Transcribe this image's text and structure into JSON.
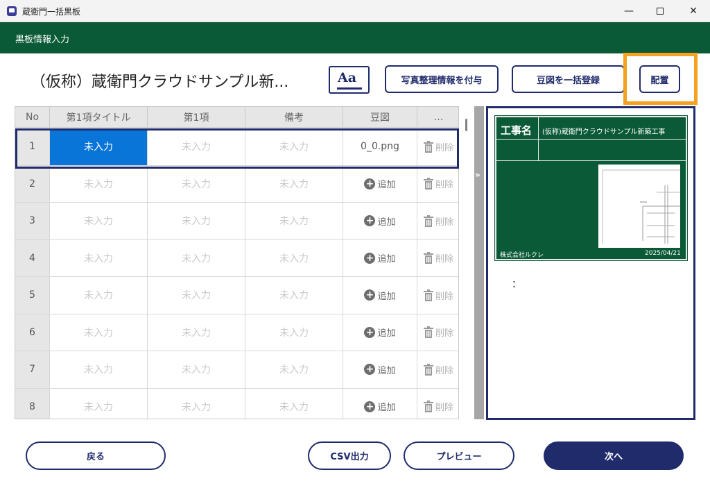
{
  "window": {
    "title": "蔵衛門一括黒板",
    "minimize": "—",
    "close": "✕"
  },
  "header": {
    "label": "黒板情報入力"
  },
  "toolbar": {
    "project_title": "（仮称）蔵衛門クラウドサンプル新...",
    "font_button": "Aa",
    "photo_info_button": "写真整理情報を付与",
    "bulk_register_button": "豆図を一括登録",
    "layout_button": "配置"
  },
  "table": {
    "columns": [
      "No",
      "第1項タイトル",
      "第1項",
      "備考",
      "豆図",
      "…"
    ],
    "placeholder": "未入力",
    "add_label": "追加",
    "delete_label": "削除",
    "rows": [
      {
        "no": "1",
        "file": "0_0.png"
      },
      {
        "no": "2"
      },
      {
        "no": "3"
      },
      {
        "no": "4"
      },
      {
        "no": "5"
      },
      {
        "no": "6"
      },
      {
        "no": "7"
      },
      {
        "no": "8"
      }
    ]
  },
  "divider": {
    "chevron": "»"
  },
  "preview": {
    "board_key": "工事名",
    "board_value": "(仮称)蔵衛門クラウドサンプル新築工事",
    "company": "株式会社ルクレ",
    "date": "2025/04/21",
    "colon": "："
  },
  "footer": {
    "back": "戻る",
    "csv": "CSV出力",
    "preview": "プレビュー",
    "next": "次へ"
  },
  "colors": {
    "brand_green": "#0b5a37",
    "navy": "#1f2b6b",
    "selected_blue": "#0a75d8",
    "highlight_orange": "#f5a01e"
  }
}
